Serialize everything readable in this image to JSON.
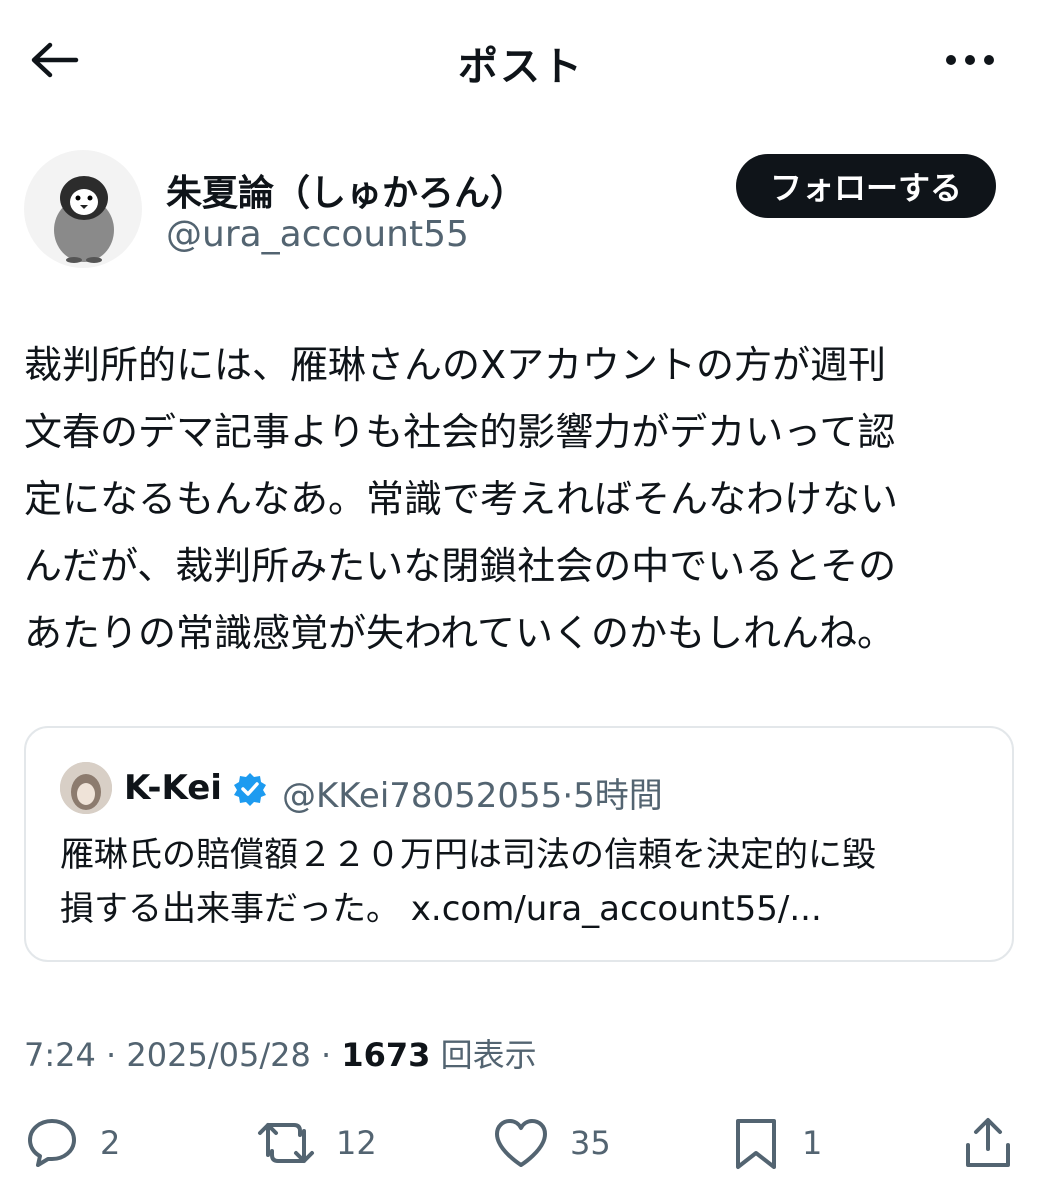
{
  "header": {
    "title": "ポスト"
  },
  "author": {
    "display_name": "朱夏論（しゅかろん）",
    "handle": "@ura_account55",
    "follow_label": "フォローする"
  },
  "post": {
    "text": "裁判所的には、雁琳さんのXアカウントの方が週刊\n文春のデマ記事よりも社会的影響力がデカいって認\n定になるもんなあ。常識で考えればそんなわけない\nんだが、裁判所みたいな閉鎖社会の中でいるとその\nあたりの常識感覚が失われていくのかもしれんね。"
  },
  "quote": {
    "name": "K-Kei",
    "verified": true,
    "handle": "@KKei78052055",
    "separator": "·",
    "time": "5時間",
    "text": "雁琳氏の賠償額２２０万円は司法の信頼を決定的に毀\n損する出来事だった。 x.com/ura_account55/..."
  },
  "meta": {
    "time": "7:24",
    "date": "2025/05/28",
    "separator": "·",
    "views": "1673",
    "views_label": "回表示"
  },
  "actions": {
    "replies": "2",
    "reposts": "12",
    "likes": "35",
    "bookmarks": "1"
  },
  "colors": {
    "text": "#0f1419",
    "secondary": "#536471",
    "verified": "#1d9bf0",
    "border": "#e3e7ea"
  },
  "icons": [
    "back-arrow-icon",
    "more-icon",
    "penguin-avatar",
    "verified-badge-icon",
    "reply-icon",
    "repost-icon",
    "like-icon",
    "bookmark-icon",
    "share-icon"
  ]
}
